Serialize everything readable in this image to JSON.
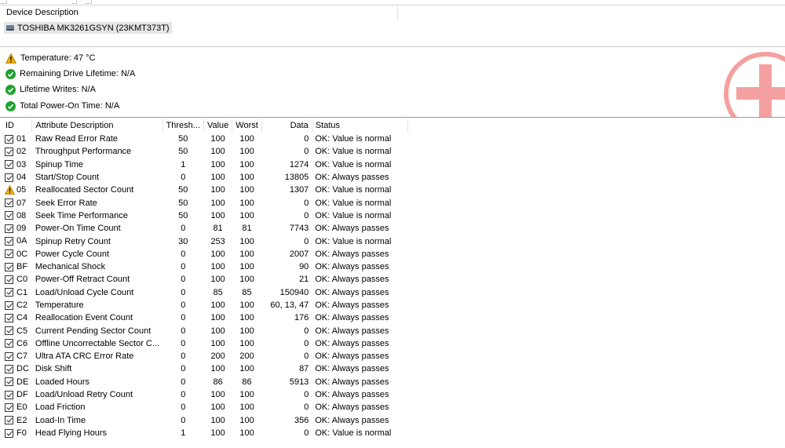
{
  "device_panel": {
    "header": "Device Description",
    "device_name": "TOSHIBA MK3261GSYN (23KMT373T)"
  },
  "health": [
    {
      "status": "warning",
      "icon": "warning-icon",
      "text": "Temperature: 47 °C"
    },
    {
      "status": "ok",
      "icon": "check-icon",
      "text": "Remaining Drive Lifetime: N/A"
    },
    {
      "status": "ok",
      "icon": "check-icon",
      "text": "Lifetime Writes: N/A"
    },
    {
      "status": "ok",
      "icon": "check-icon",
      "text": "Total Power-On Time: N/A"
    }
  ],
  "table": {
    "columns": {
      "id": "ID",
      "description": "Attribute Description",
      "threshold": "Thresh...",
      "value": "Value",
      "worst": "Worst",
      "data": "Data",
      "status": "Status"
    },
    "rows": [
      {
        "id": "01",
        "desc": "Raw Read Error Rate",
        "thresh": "50",
        "value": "100",
        "worst": "100",
        "data": "0",
        "status": "OK: Value is normal",
        "warn": false
      },
      {
        "id": "02",
        "desc": "Throughput Performance",
        "thresh": "50",
        "value": "100",
        "worst": "100",
        "data": "0",
        "status": "OK: Value is normal",
        "warn": false
      },
      {
        "id": "03",
        "desc": "Spinup Time",
        "thresh": "1",
        "value": "100",
        "worst": "100",
        "data": "1274",
        "status": "OK: Value is normal",
        "warn": false
      },
      {
        "id": "04",
        "desc": "Start/Stop Count",
        "thresh": "0",
        "value": "100",
        "worst": "100",
        "data": "13805",
        "status": "OK: Always passes",
        "warn": false
      },
      {
        "id": "05",
        "desc": "Reallocated Sector Count",
        "thresh": "50",
        "value": "100",
        "worst": "100",
        "data": "1307",
        "status": "OK: Value is normal",
        "warn": true
      },
      {
        "id": "07",
        "desc": "Seek Error Rate",
        "thresh": "50",
        "value": "100",
        "worst": "100",
        "data": "0",
        "status": "OK: Value is normal",
        "warn": false
      },
      {
        "id": "08",
        "desc": "Seek Time Performance",
        "thresh": "50",
        "value": "100",
        "worst": "100",
        "data": "0",
        "status": "OK: Value is normal",
        "warn": false
      },
      {
        "id": "09",
        "desc": "Power-On Time Count",
        "thresh": "0",
        "value": "81",
        "worst": "81",
        "data": "7743",
        "status": "OK: Always passes",
        "warn": false
      },
      {
        "id": "0A",
        "desc": "Spinup Retry Count",
        "thresh": "30",
        "value": "253",
        "worst": "100",
        "data": "0",
        "status": "OK: Value is normal",
        "warn": false
      },
      {
        "id": "0C",
        "desc": "Power Cycle Count",
        "thresh": "0",
        "value": "100",
        "worst": "100",
        "data": "2007",
        "status": "OK: Always passes",
        "warn": false
      },
      {
        "id": "BF",
        "desc": "Mechanical Shock",
        "thresh": "0",
        "value": "100",
        "worst": "100",
        "data": "90",
        "status": "OK: Always passes",
        "warn": false
      },
      {
        "id": "C0",
        "desc": "Power-Off Retract Count",
        "thresh": "0",
        "value": "100",
        "worst": "100",
        "data": "21",
        "status": "OK: Always passes",
        "warn": false
      },
      {
        "id": "C1",
        "desc": "Load/Unload Cycle Count",
        "thresh": "0",
        "value": "85",
        "worst": "85",
        "data": "150940",
        "status": "OK: Always passes",
        "warn": false
      },
      {
        "id": "C2",
        "desc": "Temperature",
        "thresh": "0",
        "value": "100",
        "worst": "100",
        "data": "60, 13, 47",
        "status": "OK: Always passes",
        "warn": false
      },
      {
        "id": "C4",
        "desc": "Reallocation Event Count",
        "thresh": "0",
        "value": "100",
        "worst": "100",
        "data": "176",
        "status": "OK: Always passes",
        "warn": false
      },
      {
        "id": "C5",
        "desc": "Current Pending Sector Count",
        "thresh": "0",
        "value": "100",
        "worst": "100",
        "data": "0",
        "status": "OK: Always passes",
        "warn": false
      },
      {
        "id": "C6",
        "desc": "Offline Uncorrectable Sector C...",
        "thresh": "0",
        "value": "100",
        "worst": "100",
        "data": "0",
        "status": "OK: Always passes",
        "warn": false
      },
      {
        "id": "C7",
        "desc": "Ultra ATA CRC Error Rate",
        "thresh": "0",
        "value": "200",
        "worst": "200",
        "data": "0",
        "status": "OK: Always passes",
        "warn": false
      },
      {
        "id": "DC",
        "desc": "Disk Shift",
        "thresh": "0",
        "value": "100",
        "worst": "100",
        "data": "87",
        "status": "OK: Always passes",
        "warn": false
      },
      {
        "id": "DE",
        "desc": "Loaded Hours",
        "thresh": "0",
        "value": "86",
        "worst": "86",
        "data": "5913",
        "status": "OK: Always passes",
        "warn": false
      },
      {
        "id": "DF",
        "desc": "Load/Unload Retry Count",
        "thresh": "0",
        "value": "100",
        "worst": "100",
        "data": "0",
        "status": "OK: Always passes",
        "warn": false
      },
      {
        "id": "E0",
        "desc": "Load Friction",
        "thresh": "0",
        "value": "100",
        "worst": "100",
        "data": "0",
        "status": "OK: Always passes",
        "warn": false
      },
      {
        "id": "E2",
        "desc": "Load-In Time",
        "thresh": "0",
        "value": "100",
        "worst": "100",
        "data": "356",
        "status": "OK: Always passes",
        "warn": false
      },
      {
        "id": "F0",
        "desc": "Head Flying Hours",
        "thresh": "1",
        "value": "100",
        "worst": "100",
        "data": "0",
        "status": "OK: Value is normal",
        "warn": false
      }
    ]
  },
  "colors": {
    "ok": "#1fa12f",
    "warning": "#f2b200",
    "badge_cross": "#f4a0a0"
  }
}
